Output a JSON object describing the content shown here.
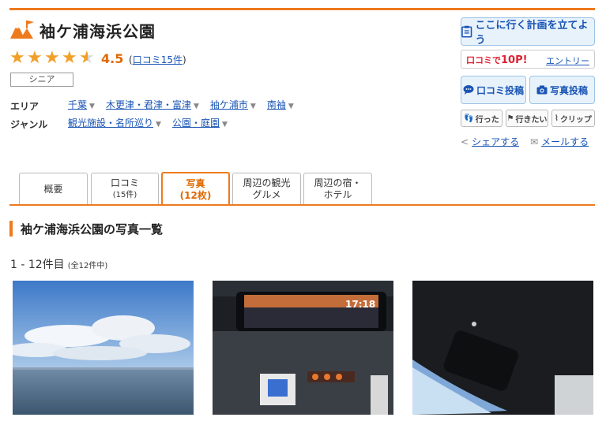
{
  "page": {
    "title": "袖ケ浦海浜公園",
    "rating": "4.5",
    "reviews_link": "口コミ15件",
    "tag": "シニア",
    "stars": [
      1,
      1,
      1,
      1,
      0.5
    ]
  },
  "meta": {
    "area_label": "エリア",
    "area_links": [
      "千葉",
      "木更津・君津・富津",
      "袖ケ浦市",
      "南袖"
    ],
    "genre_label": "ジャンル",
    "genre_links": [
      "観光施設・名所巡り",
      "公園・庭園"
    ]
  },
  "actions": {
    "plan": "ここに行く計画を立てよう",
    "entry_prefix": "口コミで",
    "entry_points": "10P!",
    "entry_link": "エントリー",
    "post_review": "口コミ投稿",
    "post_photo": "写真投稿",
    "went": "行った",
    "want": "行きたい",
    "clip": "クリップ",
    "share": "シェアする",
    "mail": "メールする"
  },
  "tabs": [
    {
      "label": "概要",
      "sub": ""
    },
    {
      "label": "口コミ",
      "sub": "(15件)"
    },
    {
      "label": "写真",
      "sub": "(12枚)"
    },
    {
      "label": "周辺の観光",
      "sub": "グルメ"
    },
    {
      "label": "周辺の宿・",
      "sub": "ホテル"
    }
  ],
  "active_tab": 2,
  "section": {
    "heading": "袖ケ浦海浜公園の写真一覧",
    "count": "1 - 12件目",
    "total": "(全12件中)"
  },
  "colors": {
    "accent": "#ee7a1e",
    "link": "#1a55b5",
    "star": "#f0a028"
  }
}
